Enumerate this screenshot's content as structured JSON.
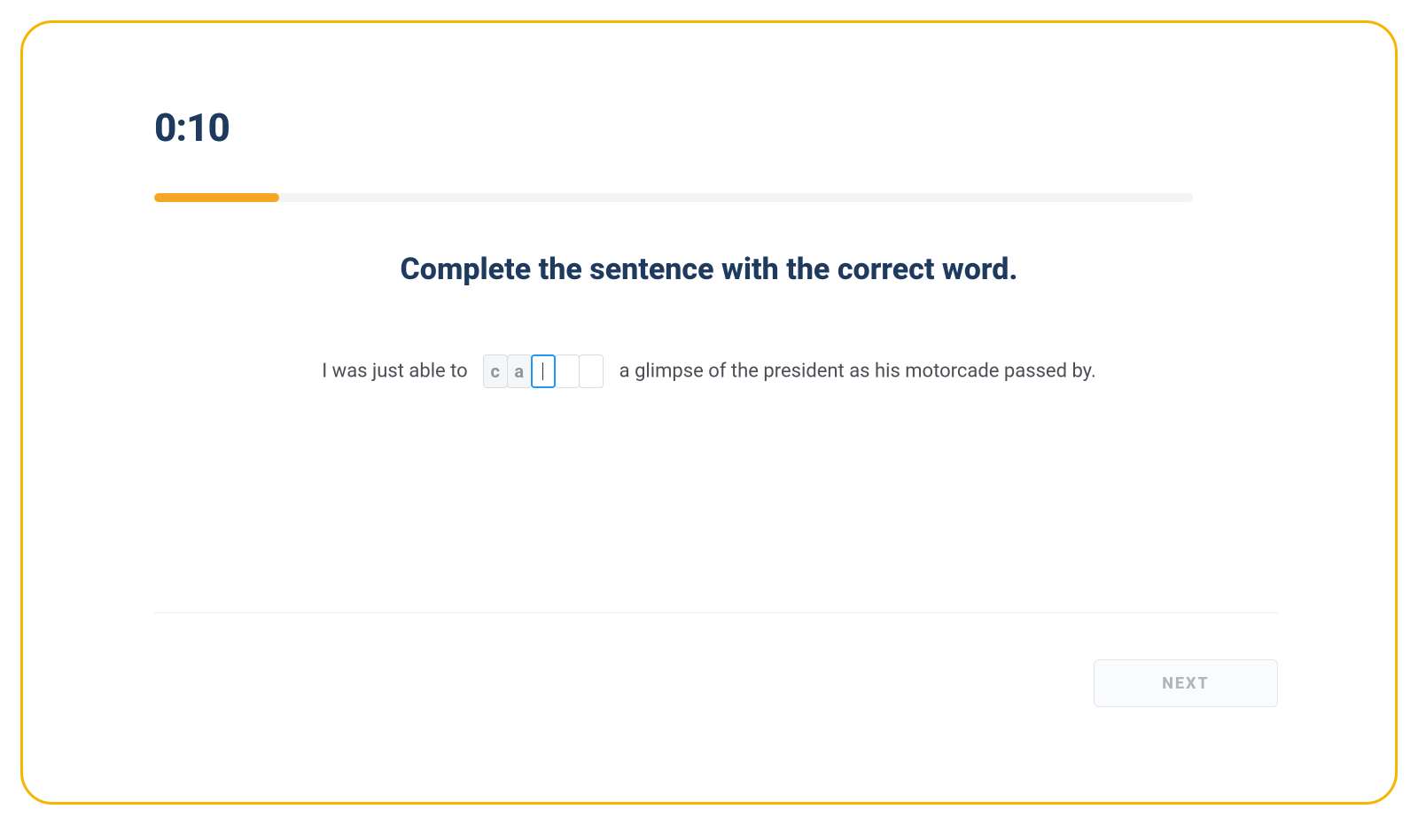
{
  "timer": "0:10",
  "progress": {
    "percent": 12
  },
  "instruction": "Complete the sentence with the correct word.",
  "sentence": {
    "before": "I was just able to",
    "letters": [
      "c",
      "a",
      "",
      "",
      ""
    ],
    "active_index": 2,
    "after": "a glimpse of the president as his motorcade passed by."
  },
  "footer": {
    "next_label": "NEXT"
  }
}
